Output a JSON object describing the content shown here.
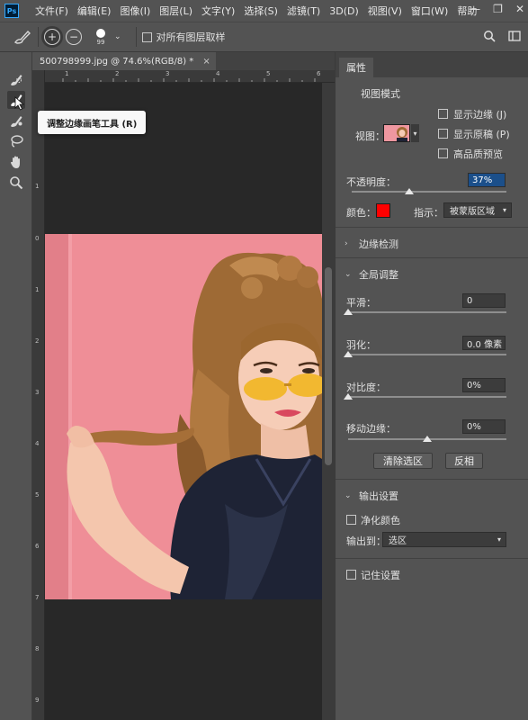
{
  "app": {
    "logo": "Ps"
  },
  "menubar": {
    "items": [
      "文件(F)",
      "编辑(E)",
      "图像(I)",
      "图层(L)",
      "文字(Y)",
      "选择(S)",
      "滤镜(T)",
      "3D(D)",
      "视图(V)",
      "窗口(W)",
      "帮助"
    ]
  },
  "options_bar": {
    "brush_size": "99",
    "sample_all_layers_label": "对所有图层取样",
    "sample_all_layers_checked": false
  },
  "document": {
    "tab_title": "500798999.jpg @ 74.6%(RGB/8) *",
    "close_glyph": "×"
  },
  "rulers": {
    "top": [
      "1",
      "2",
      "3",
      "4",
      "5",
      "6"
    ],
    "left": [
      "1",
      "0",
      "1",
      "2",
      "3",
      "4",
      "5",
      "6",
      "7",
      "8",
      "9"
    ]
  },
  "tooltip": {
    "text": "调整边缘画笔工具 (R)"
  },
  "properties": {
    "tab_label": "属性",
    "view_mode": {
      "title": "视图模式",
      "view_label": "视图：",
      "show_edge_label": "显示边缘 (J)",
      "show_edge_checked": false,
      "show_original_label": "显示原稿 (P)",
      "show_original_checked": false,
      "hq_preview_label": "高品质预览",
      "hq_preview_checked": false
    },
    "opacity": {
      "label": "不透明度：",
      "value": "37%",
      "fraction": 0.37
    },
    "color": {
      "label": "颜色：",
      "swatch": "#ff0000"
    },
    "indicate": {
      "label": "指示：",
      "value": "被蒙版区域"
    },
    "edge_detection": {
      "label": "边缘检测",
      "expanded": false
    },
    "global_refine": {
      "label": "全局调整",
      "expanded": true,
      "smooth": {
        "label": "平滑：",
        "value": "0",
        "fraction": 0.0
      },
      "feather": {
        "label": "羽化：",
        "value": "0.0 像素",
        "fraction": 0.0
      },
      "contrast": {
        "label": "对比度：",
        "value": "0%",
        "fraction": 0.0
      },
      "shift_edge": {
        "label": "移动边缘：",
        "value": "0%",
        "fraction": 0.5
      },
      "clear_selection_label": "清除选区",
      "invert_label": "反相"
    },
    "output": {
      "label": "输出设置",
      "expanded": true,
      "decontaminate_label": "净化颜色",
      "decontaminate_checked": false,
      "output_to_label": "输出到：",
      "output_to_value": "选区",
      "remember_label": "记住设置",
      "remember_checked": false
    }
  },
  "icons": {
    "menubar_right": [
      "minimize-icon",
      "restore-icon",
      "close-icon"
    ],
    "tools": [
      "quick-selection-icon",
      "refine-edge-brush-icon",
      "brush-icon",
      "lasso-icon",
      "hand-icon",
      "zoom-icon"
    ]
  },
  "colors": {
    "image_background": "#ef8e97",
    "accent_selection": "#1b4f8a"
  }
}
